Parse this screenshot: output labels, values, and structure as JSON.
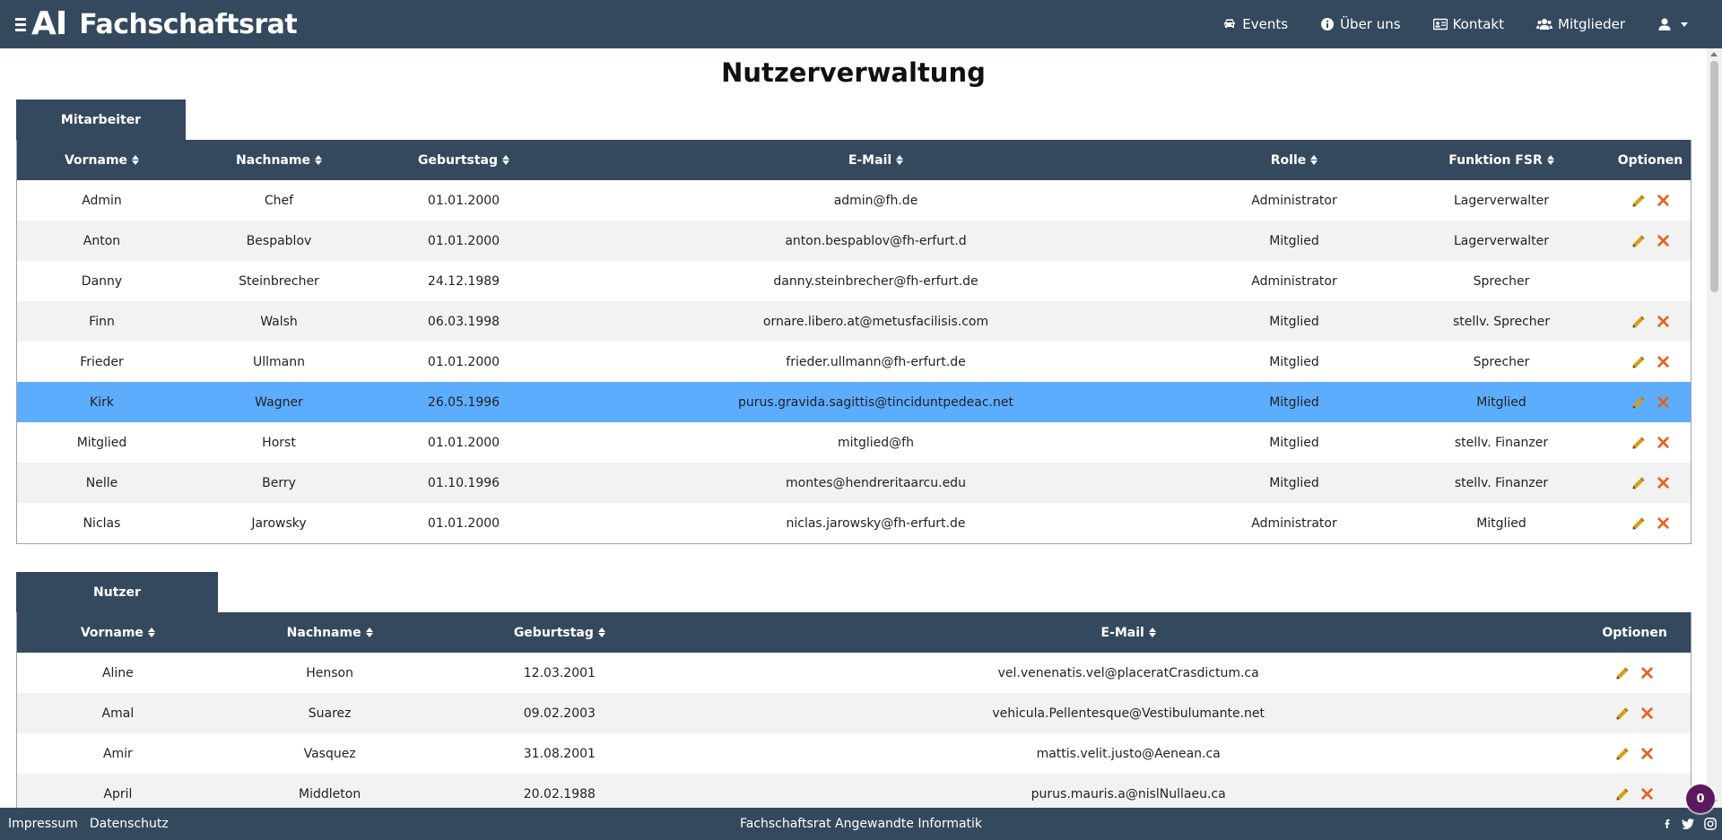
{
  "brand": {
    "logo_text": "AI",
    "name": "Fachschaftsrat"
  },
  "nav": {
    "items": [
      {
        "label": "Events",
        "icon": "car-icon"
      },
      {
        "label": "Über uns",
        "icon": "info-circle-icon"
      },
      {
        "label": "Kontakt",
        "icon": "id-card-icon"
      },
      {
        "label": "Mitglieder",
        "icon": "users-icon"
      }
    ],
    "user_icon": "user-icon"
  },
  "page": {
    "title": "Nutzerverwaltung"
  },
  "mitarbeiter": {
    "tab_label": "Mitarbeiter",
    "columns": [
      "Vorname",
      "Nachname",
      "Geburtstag",
      "E-Mail",
      "Rolle",
      "Funktion FSR",
      "Optionen"
    ],
    "rows": [
      {
        "vorname": "Admin",
        "nachname": "Chef",
        "geburtstag": "01.01.2000",
        "email": "admin@fh.de",
        "rolle": "Administrator",
        "funktion": "Lagerverwalter",
        "options": true
      },
      {
        "vorname": "Anton",
        "nachname": "Bespablov",
        "geburtstag": "01.01.2000",
        "email": "anton.bespablov@fh-erfurt.d",
        "rolle": "Mitglied",
        "funktion": "Lagerverwalter",
        "options": true
      },
      {
        "vorname": "Danny",
        "nachname": "Steinbrecher",
        "geburtstag": "24.12.1989",
        "email": "danny.steinbrecher@fh-erfurt.de",
        "rolle": "Administrator",
        "funktion": "Sprecher",
        "options": false
      },
      {
        "vorname": "Finn",
        "nachname": "Walsh",
        "geburtstag": "06.03.1998",
        "email": "ornare.libero.at@metusfacilisis.com",
        "rolle": "Mitglied",
        "funktion": "stellv. Sprecher",
        "options": true
      },
      {
        "vorname": "Frieder",
        "nachname": "Ullmann",
        "geburtstag": "01.01.2000",
        "email": "frieder.ullmann@fh-erfurt.de",
        "rolle": "Mitglied",
        "funktion": "Sprecher",
        "options": true
      },
      {
        "vorname": "Kirk",
        "nachname": "Wagner",
        "geburtstag": "26.05.1996",
        "email": "purus.gravida.sagittis@tinciduntpedeac.net",
        "rolle": "Mitglied",
        "funktion": "Mitglied",
        "options": true,
        "selected": true
      },
      {
        "vorname": "Mitglied",
        "nachname": "Horst",
        "geburtstag": "01.01.2000",
        "email": "mitglied@fh",
        "rolle": "Mitglied",
        "funktion": "stellv. Finanzer",
        "options": true
      },
      {
        "vorname": "Nelle",
        "nachname": "Berry",
        "geburtstag": "01.10.1996",
        "email": "montes@hendreritaarcu.edu",
        "rolle": "Mitglied",
        "funktion": "stellv. Finanzer",
        "options": true
      },
      {
        "vorname": "Niclas",
        "nachname": "Jarowsky",
        "geburtstag": "01.01.2000",
        "email": "niclas.jarowsky@fh-erfurt.de",
        "rolle": "Administrator",
        "funktion": "Mitglied",
        "options": true
      }
    ]
  },
  "nutzer": {
    "tab_label": "Nutzer",
    "columns": [
      "Vorname",
      "Nachname",
      "Geburtstag",
      "E-Mail",
      "Optionen"
    ],
    "rows": [
      {
        "vorname": "Aline",
        "nachname": "Henson",
        "geburtstag": "12.03.2001",
        "email": "vel.venenatis.vel@placeratCrasdictum.ca"
      },
      {
        "vorname": "Amal",
        "nachname": "Suarez",
        "geburtstag": "09.02.2003",
        "email": "vehicula.Pellentesque@Vestibulumante.net"
      },
      {
        "vorname": "Amir",
        "nachname": "Vasquez",
        "geburtstag": "31.08.2001",
        "email": "mattis.velit.justo@Aenean.ca"
      },
      {
        "vorname": "April",
        "nachname": "Middleton",
        "geburtstag": "20.02.1988",
        "email": "purus.mauris.a@nislNullaeu.ca"
      }
    ]
  },
  "footer": {
    "links": [
      "Impressum",
      "Datenschutz"
    ],
    "center_text": "Fachschaftsrat Angewandte Informatik",
    "social": [
      "facebook-icon",
      "twitter-icon",
      "instagram-icon"
    ]
  },
  "badge": {
    "count": "0"
  },
  "colors": {
    "navbar": "#34495e",
    "selected_row": "#5dadff",
    "pencil": "#d4a017",
    "delete": "#e8601c",
    "badge": "#5b1a5e"
  }
}
